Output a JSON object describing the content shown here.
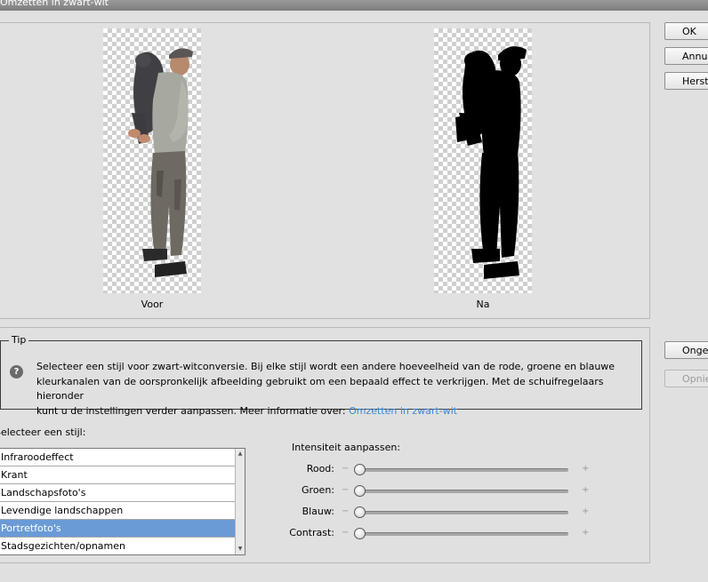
{
  "window": {
    "title": "Omzetten in zwart-wit"
  },
  "preview": {
    "before_label": "Voor",
    "after_label": "Na"
  },
  "buttons": {
    "ok": "OK",
    "cancel": "Annuleren",
    "reset": "Herstellen",
    "undo": "Ongedaan maken",
    "redo": "Opnieuw"
  },
  "tip": {
    "legend": "Tip",
    "line1": "Selecteer een stijl voor zwart-witconversie. Bij elke stijl wordt een andere hoeveelheid van de rode, groene en blauwe",
    "line2": "kleurkanalen van de oorspronkelijk afbeelding gebruikt om een bepaald effect te verkrijgen. Met de schuifregelaars hieronder",
    "line3": "kunt u de instellingen verder aanpassen. Meer informatie over: ",
    "link": "Omzetten in zwart-wit",
    "icon": "help-icon"
  },
  "style_list": {
    "label": "Selecteer een stijl:",
    "items": [
      "Infraroodeffect",
      "Krant",
      "Landschapsfoto's",
      "Levendige landschappen",
      "Portretfoto's",
      "Stadsgezichten/opnamen"
    ],
    "selected": "Portretfoto's"
  },
  "intensity": {
    "label": "Intensiteit aanpassen:",
    "minus": "−",
    "plus": "+",
    "sliders": [
      {
        "label": "Rood:",
        "level": 0
      },
      {
        "label": "Groen:",
        "level": 0
      },
      {
        "label": "Blauw:",
        "level": 0
      },
      {
        "label": "Contrast:",
        "level": 0
      }
    ]
  },
  "colors": {
    "selection": "#6a9bd6",
    "link": "#3a86d6"
  }
}
